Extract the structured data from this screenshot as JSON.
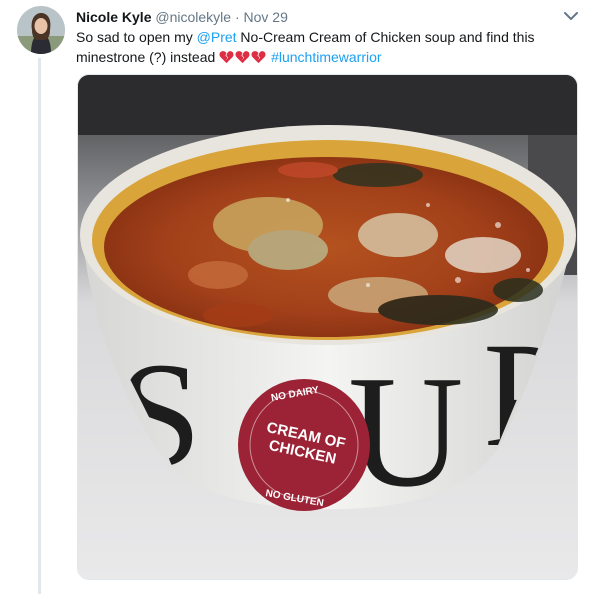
{
  "tweet": {
    "name": "Nicole Kyle",
    "handle": "@nicolekyle",
    "separator": "·",
    "time": "Nov 29",
    "text_part1": "So sad to open my ",
    "mention": "@Pret",
    "text_part2": " No-Cream Cream of Chicken soup and find this minestrone (?) instead ",
    "hashtag": "#lunchtimewarrior",
    "emojis": [
      "broken-heart-emoji",
      "broken-heart-emoji",
      "broken-heart-emoji"
    ]
  },
  "photo": {
    "cup_brand_letters": "SOUP",
    "sticker_top": "NO DAIRY",
    "sticker_main_line1": "CREAM OF",
    "sticker_main_line2": "CHICKEN",
    "sticker_bottom": "NO GLUTEN"
  },
  "colors": {
    "link": "#1da1f2",
    "broken_heart": "#dd2e44",
    "sticker": "#9b2335"
  }
}
